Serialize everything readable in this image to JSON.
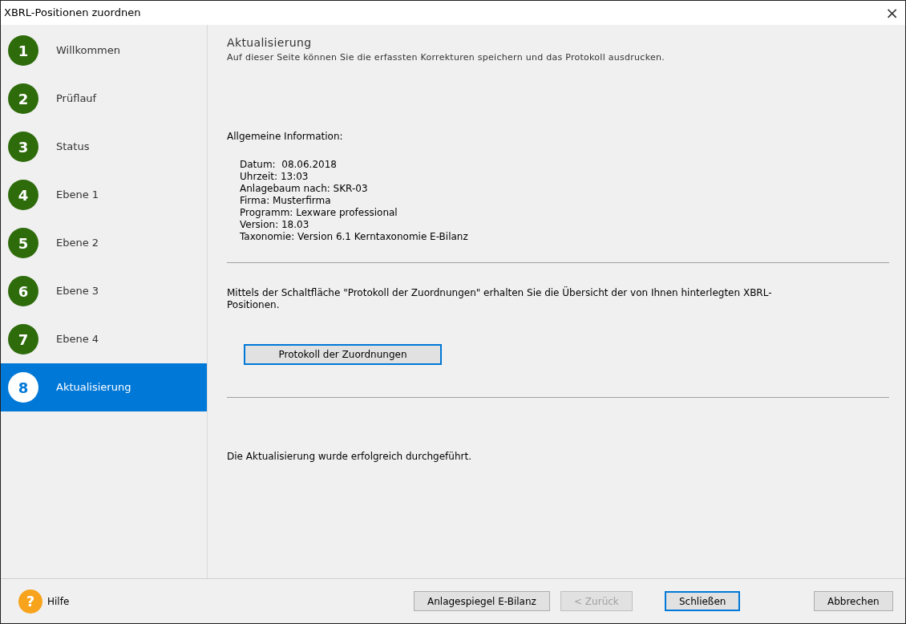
{
  "window": {
    "title": "XBRL-Positionen zuordnen",
    "close": "×"
  },
  "steps": [
    {
      "number": "1",
      "label": "Willkommen",
      "selected": false
    },
    {
      "number": "2",
      "label": "Prüflauf",
      "selected": false
    },
    {
      "number": "3",
      "label": "Status",
      "selected": false
    },
    {
      "number": "4",
      "label": "Ebene 1",
      "selected": false
    },
    {
      "number": "5",
      "label": "Ebene 2",
      "selected": false
    },
    {
      "number": "6",
      "label": "Ebene 3",
      "selected": false
    },
    {
      "number": "7",
      "label": "Ebene 4",
      "selected": false
    },
    {
      "number": "8",
      "label": "Aktualisierung",
      "selected": true
    }
  ],
  "page": {
    "title": "Aktualisierung",
    "subtitle": "Auf dieser Seite können Sie die erfassten Korrekturen speichern und das Protokoll ausdrucken.",
    "info_heading": "Allgemeine Information:",
    "info_lines": [
      "Datum:  08.06.2018",
      "Uhrzeit: 13:03",
      "Anlagebaum nach: SKR-03",
      "Firma: Musterfirma",
      "Programm: Lexware professional",
      "Version: 18.03",
      "Taxonomie: Version 6.1 Kerntaxonomie E-Bilanz"
    ],
    "protocol_text": "Mittels der Schaltfläche \"Protokoll der Zuordnungen\" erhalten Sie die Übersicht der von Ihnen hinterlegten XBRL-Positionen.",
    "protocol_button": {
      "label": "Protokoll der Zuordnungen",
      "focused": true
    },
    "result_text": "Die Aktualisierung wurde erfolgreich durchgeführt."
  },
  "footer": {
    "help_icon": "?",
    "help_label": "Hilfe",
    "buttons": [
      {
        "label": "Anlagespiegel E-Bilanz",
        "disabled": false,
        "focused": false
      },
      {
        "label": "< Zurück",
        "disabled": true,
        "focused": false
      },
      {
        "label": "Schließen",
        "disabled": false,
        "focused": true
      },
      {
        "label": "Abbrechen",
        "disabled": false,
        "focused": false
      }
    ]
  }
}
